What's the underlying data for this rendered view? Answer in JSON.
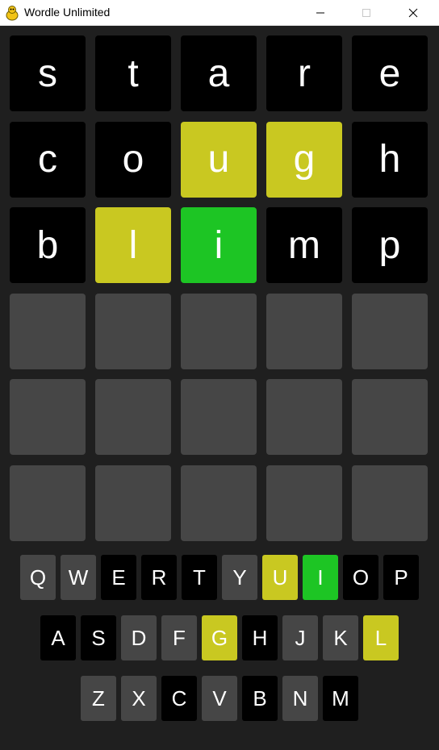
{
  "window": {
    "title": "Wordle Unlimited"
  },
  "colors": {
    "background": "#1f1f1f",
    "empty": "#464646",
    "absent": "#000000",
    "present": "#c9c821",
    "correct": "#1dc524",
    "unused_key": "#464646"
  },
  "board": {
    "rows": [
      [
        {
          "letter": "s",
          "state": "absent"
        },
        {
          "letter": "t",
          "state": "absent"
        },
        {
          "letter": "a",
          "state": "absent"
        },
        {
          "letter": "r",
          "state": "absent"
        },
        {
          "letter": "e",
          "state": "absent"
        }
      ],
      [
        {
          "letter": "c",
          "state": "absent"
        },
        {
          "letter": "o",
          "state": "absent"
        },
        {
          "letter": "u",
          "state": "present"
        },
        {
          "letter": "g",
          "state": "present"
        },
        {
          "letter": "h",
          "state": "absent"
        }
      ],
      [
        {
          "letter": "b",
          "state": "absent"
        },
        {
          "letter": "l",
          "state": "present"
        },
        {
          "letter": "i",
          "state": "correct"
        },
        {
          "letter": "m",
          "state": "absent"
        },
        {
          "letter": "p",
          "state": "absent"
        }
      ],
      [
        {
          "letter": "",
          "state": "empty"
        },
        {
          "letter": "",
          "state": "empty"
        },
        {
          "letter": "",
          "state": "empty"
        },
        {
          "letter": "",
          "state": "empty"
        },
        {
          "letter": "",
          "state": "empty"
        }
      ],
      [
        {
          "letter": "",
          "state": "empty"
        },
        {
          "letter": "",
          "state": "empty"
        },
        {
          "letter": "",
          "state": "empty"
        },
        {
          "letter": "",
          "state": "empty"
        },
        {
          "letter": "",
          "state": "empty"
        }
      ],
      [
        {
          "letter": "",
          "state": "empty"
        },
        {
          "letter": "",
          "state": "empty"
        },
        {
          "letter": "",
          "state": "empty"
        },
        {
          "letter": "",
          "state": "empty"
        },
        {
          "letter": "",
          "state": "empty"
        }
      ]
    ]
  },
  "keyboard": {
    "rows": [
      [
        {
          "key": "Q",
          "state": "unused"
        },
        {
          "key": "W",
          "state": "unused"
        },
        {
          "key": "E",
          "state": "absent"
        },
        {
          "key": "R",
          "state": "absent"
        },
        {
          "key": "T",
          "state": "absent"
        },
        {
          "key": "Y",
          "state": "unused"
        },
        {
          "key": "U",
          "state": "present"
        },
        {
          "key": "I",
          "state": "correct"
        },
        {
          "key": "O",
          "state": "absent"
        },
        {
          "key": "P",
          "state": "absent"
        }
      ],
      [
        {
          "key": "A",
          "state": "absent"
        },
        {
          "key": "S",
          "state": "absent"
        },
        {
          "key": "D",
          "state": "unused"
        },
        {
          "key": "F",
          "state": "unused"
        },
        {
          "key": "G",
          "state": "present"
        },
        {
          "key": "H",
          "state": "absent"
        },
        {
          "key": "J",
          "state": "unused"
        },
        {
          "key": "K",
          "state": "unused"
        },
        {
          "key": "L",
          "state": "present"
        }
      ],
      [
        {
          "key": "Z",
          "state": "unused"
        },
        {
          "key": "X",
          "state": "unused"
        },
        {
          "key": "C",
          "state": "absent"
        },
        {
          "key": "V",
          "state": "unused"
        },
        {
          "key": "B",
          "state": "absent"
        },
        {
          "key": "N",
          "state": "unused"
        },
        {
          "key": "M",
          "state": "absent"
        }
      ]
    ]
  }
}
